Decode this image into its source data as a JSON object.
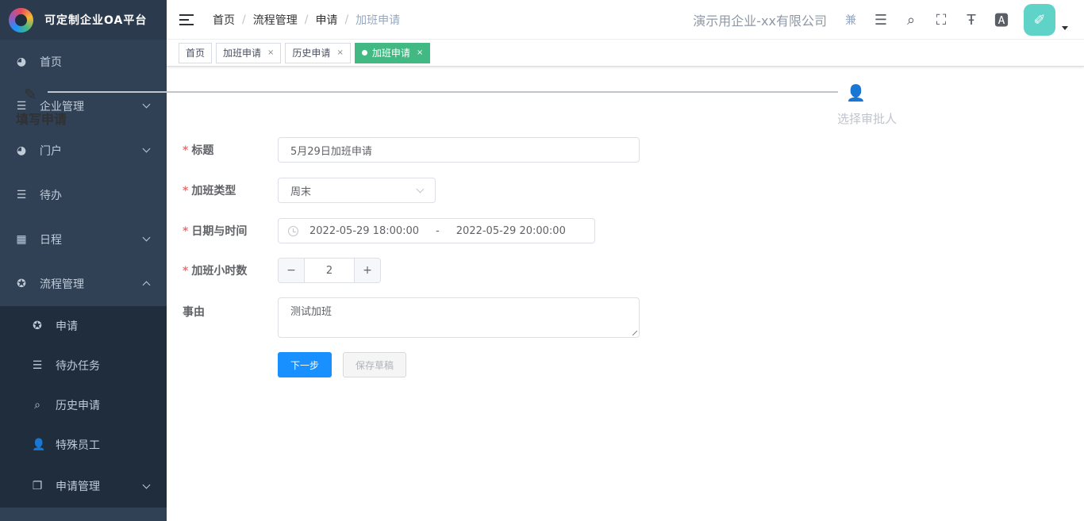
{
  "app": {
    "title": "可定制企业OA平台"
  },
  "sidebar": {
    "items": [
      {
        "label": "首页",
        "icon": "dashboard-icon"
      },
      {
        "label": "企业管理",
        "icon": "list-icon"
      },
      {
        "label": "门户",
        "icon": "dashboard-icon"
      },
      {
        "label": "待办",
        "icon": "list-icon"
      },
      {
        "label": "日程",
        "icon": "grid-icon"
      },
      {
        "label": "流程管理",
        "icon": "workflow-icon"
      }
    ],
    "sub_items": [
      {
        "label": "申请",
        "icon": "workflow-icon"
      },
      {
        "label": "待办任务",
        "icon": "list-icon"
      },
      {
        "label": "历史申请",
        "icon": "search-icon"
      },
      {
        "label": "特殊员工",
        "icon": "user-icon"
      },
      {
        "label": "申请管理",
        "icon": "document-icon"
      }
    ]
  },
  "header": {
    "breadcrumb": [
      "首页",
      "流程管理",
      "申请",
      "加班申请"
    ],
    "company": "演示用企业-xx有限公司",
    "extra_label": "兼"
  },
  "tags": [
    {
      "label": "首页"
    },
    {
      "label": "加班申请"
    },
    {
      "label": "历史申请"
    },
    {
      "label": "加班申请",
      "active": true
    }
  ],
  "steps": {
    "step1": "填写申请",
    "step2": "选择审批人"
  },
  "form": {
    "title_label": "标题",
    "title_value": "5月29日加班申请",
    "type_label": "加班类型",
    "type_value": "周末",
    "datetime_label": "日期与时间",
    "start": "2022-05-29 18:00:00",
    "range_sep": "-",
    "end": "2022-05-29 20:00:00",
    "hours_label": "加班小时数",
    "hours_value": "2",
    "reason_label": "事由",
    "reason_value": "测试加班",
    "next_label": "下一步",
    "draft_label": "保存草稿"
  },
  "colors": {
    "sidebar": "#304156",
    "accent": "#1890ff",
    "tag_active": "#42b983"
  }
}
